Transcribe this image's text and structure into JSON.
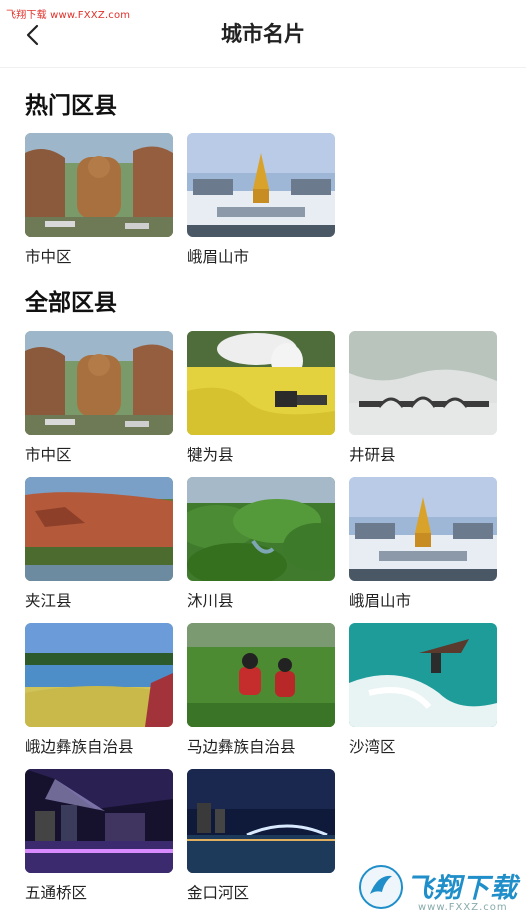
{
  "watermark_top": "飞翔下载 www.FXXZ.com",
  "header": {
    "title": "城市名片",
    "back_icon": "chevron-left-icon"
  },
  "sections": [
    {
      "title": "热门区县",
      "items": [
        {
          "label": "市中区",
          "scene": "buddha"
        },
        {
          "label": "峨眉山市",
          "scene": "emei"
        }
      ]
    },
    {
      "title": "全部区县",
      "items": [
        {
          "label": "市中区",
          "scene": "buddha"
        },
        {
          "label": "犍为县",
          "scene": "train"
        },
        {
          "label": "井研县",
          "scene": "bridge"
        },
        {
          "label": "夹江县",
          "scene": "cliff"
        },
        {
          "label": "沐川县",
          "scene": "hills"
        },
        {
          "label": "峨眉山市",
          "scene": "emei"
        },
        {
          "label": "峨边彝族自治县",
          "scene": "lake"
        },
        {
          "label": "马边彝族自治县",
          "scene": "tea"
        },
        {
          "label": "沙湾区",
          "scene": "jetski"
        },
        {
          "label": "五通桥区",
          "scene": "nightcity"
        },
        {
          "label": "金口河区",
          "scene": "nightbridge"
        }
      ]
    }
  ],
  "watermark_bottom": {
    "text": "飞翔下载",
    "sub": "www.FXXZ.com"
  }
}
